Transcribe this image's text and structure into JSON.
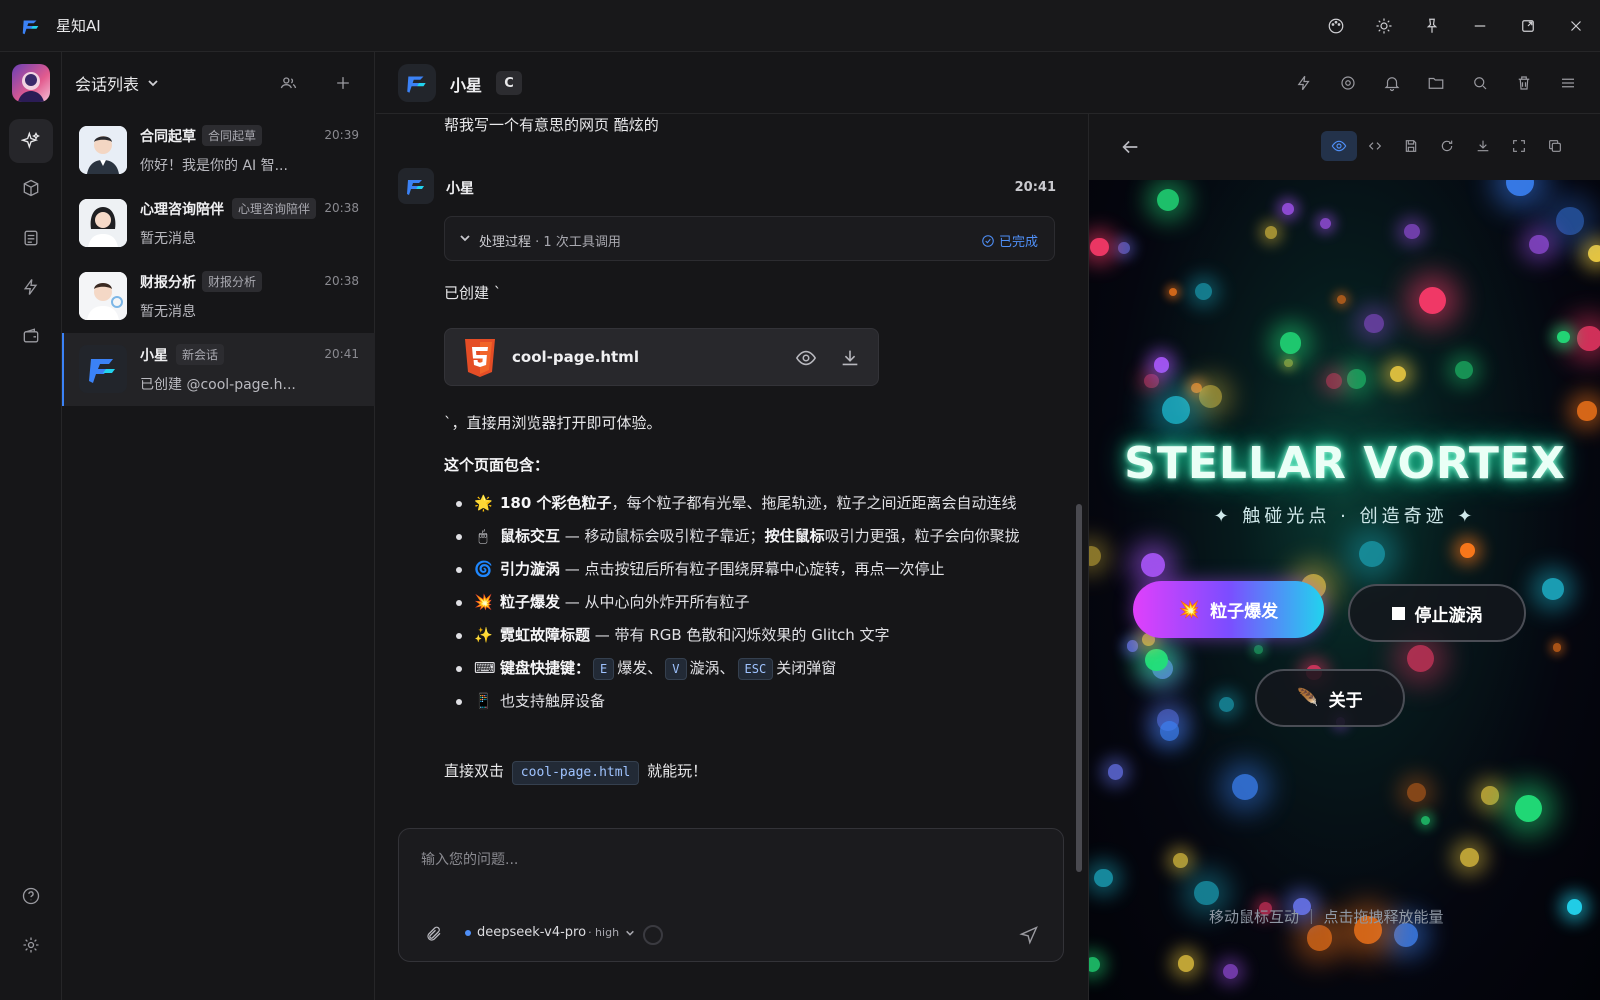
{
  "app": {
    "title": "星知AI"
  },
  "sidebar_rail": {
    "items": [
      "sparkles-icon",
      "cube-icon",
      "document-icon",
      "bolt-icon",
      "wallet-icon"
    ],
    "bottom": [
      "help-icon",
      "settings-icon"
    ]
  },
  "conversation_list": {
    "title": "会话列表",
    "items": [
      {
        "name": "合同起草",
        "tag": "合同起草",
        "time": "20:39",
        "preview": "你好！我是你的 AI 智..."
      },
      {
        "name": "心理咨询陪伴",
        "tag": "心理咨询陪伴",
        "time": "20:38",
        "preview": "暂无消息"
      },
      {
        "name": "财报分析",
        "tag": "财报分析",
        "time": "20:38",
        "preview": "暂无消息"
      },
      {
        "name": "小星",
        "tag": "新会话",
        "time": "20:41",
        "preview": "已创建 @cool-page.h..."
      }
    ]
  },
  "chat": {
    "name": "小星",
    "badge": "C",
    "user_message": "帮我写一个有意思的网页 酷炫的",
    "bot_name": "小星",
    "bot_time": "20:41",
    "process_label": "处理过程",
    "process_count": "· 1 次工具调用",
    "process_status": "已完成",
    "created_text": "已创建 `",
    "file_name": "cool-page.html",
    "after_file": "`，直接用浏览器打开即可体验。",
    "section_title": "这个页面包含：",
    "list": [
      {
        "bold": "180 个彩色粒子",
        "rest": "，每个粒子都有光晕、拖尾轨迹，粒子之间近距离会自动连线"
      },
      {
        "bold": "鼠标交互",
        "rest": " — 移动鼠标会吸引粒子靠近；",
        "bold2": "按住鼠标",
        "rest2": "吸引力更强，粒子会向你聚拢"
      },
      {
        "bold": "引力漩涡",
        "rest": " — 点击按钮后所有粒子围绕屏幕中心旋转，再点一次停止"
      },
      {
        "bold": "粒子爆发",
        "rest": " — 从中心向外炸开所有粒子"
      },
      {
        "bold": "霓虹故障标题",
        "rest": " — 带有 RGB 色散和闪烁效果的 Glitch 文字"
      },
      {
        "bold": "键盘快捷键",
        "colon": "：",
        "k1": "E",
        "t1": "爆发、",
        "k2": "V",
        "t2": "漩涡、",
        "k3": "ESC",
        "t3": "关闭弹窗"
      },
      {
        "rest": "也支持触屏设备"
      }
    ],
    "footer_pre": "直接双击",
    "footer_code": "cool-page.html",
    "footer_post": "就能玩！"
  },
  "composer": {
    "placeholder": "输入您的问题...",
    "model": "deepseek-v4-pro",
    "level": "· high"
  },
  "preview": {
    "title": "STELLAR VORTEX",
    "subtitle": "✦ 触碰光点 · 创造奇迹 ✦",
    "burst_button": "粒子爆发",
    "stop_button": "停止漩涡",
    "about_button": "关于",
    "hint": "移动鼠标互动 ｜ 点击拖拽释放能量"
  },
  "colors": {
    "accent": "#4f8ff7",
    "title_glow": "#22e0a8"
  }
}
